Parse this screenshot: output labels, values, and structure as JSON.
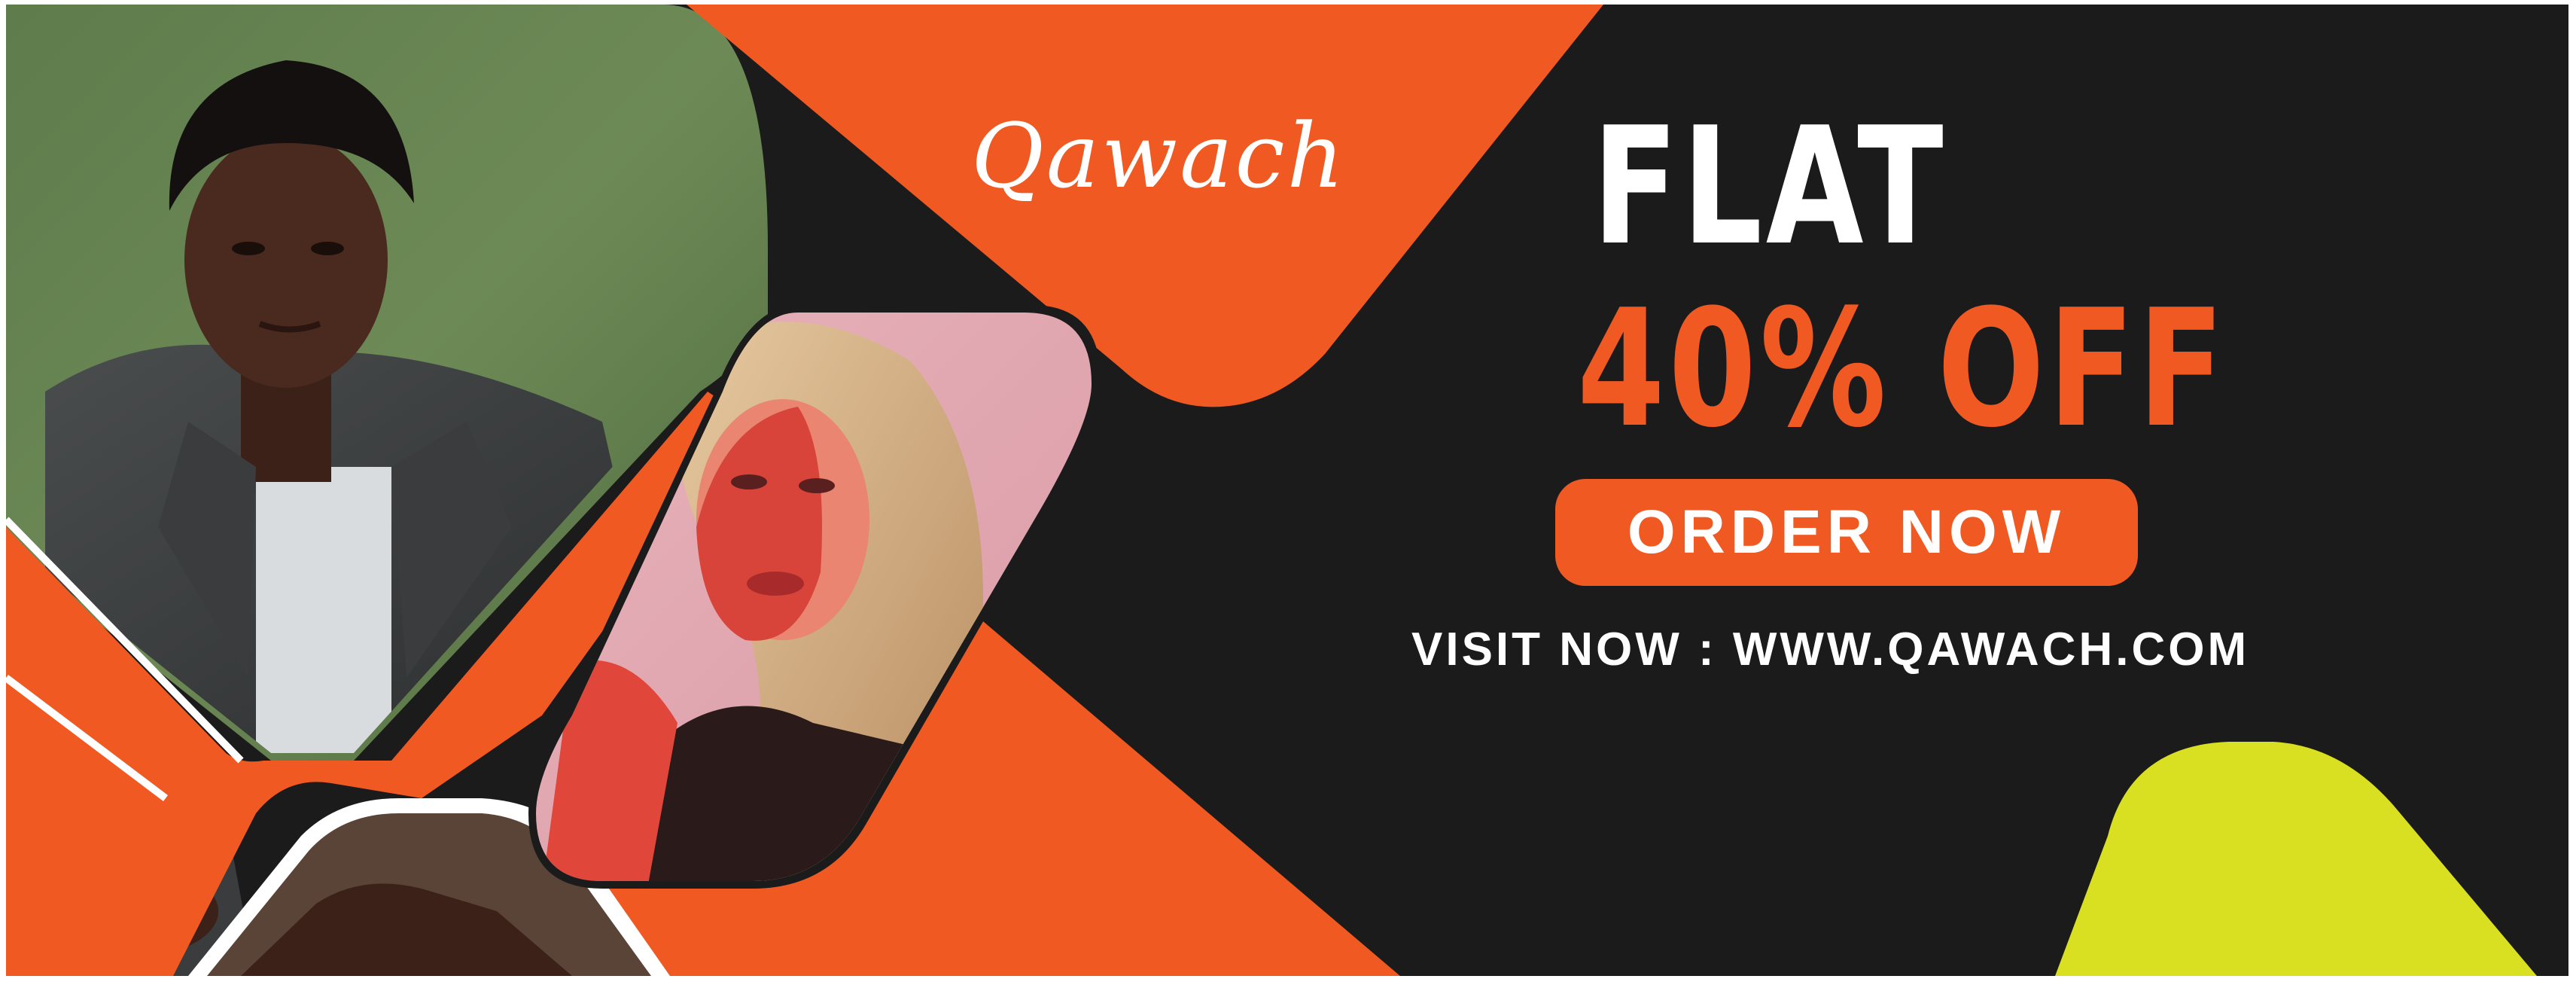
{
  "brand": {
    "name": "Qawach"
  },
  "promo": {
    "headline": "FLAT",
    "discount": "40% OFF"
  },
  "cta": {
    "label": "ORDER NOW"
  },
  "footer": {
    "visit_text": "VISIT NOW : WWW.QAWACH.COM"
  },
  "colors": {
    "background": "#1c1b1b",
    "accent": "#f05a22",
    "highlight": "#d9e021",
    "text": "#ffffff"
  },
  "images": [
    {
      "name": "man-in-leather-jacket-photo"
    },
    {
      "name": "woman-portrait-photo"
    }
  ]
}
